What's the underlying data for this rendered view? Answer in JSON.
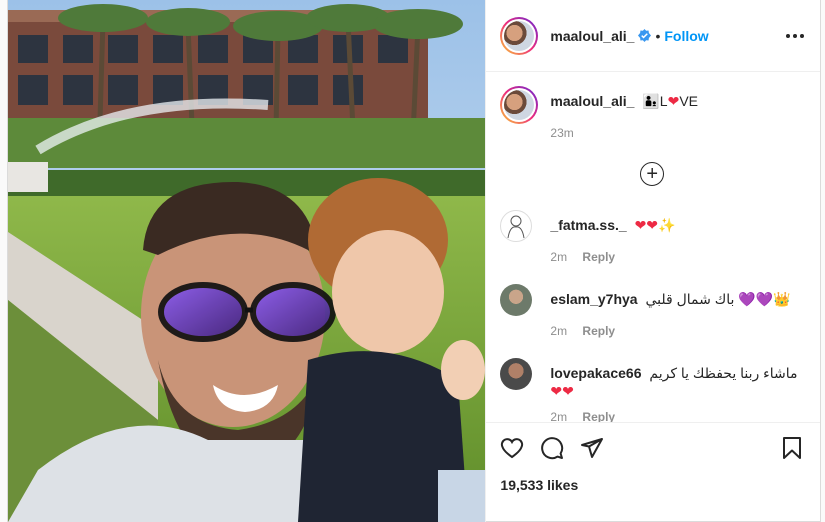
{
  "post": {
    "author": "maaloul_ali_",
    "follow_label": "Follow",
    "separator": "•",
    "caption_text": "L",
    "caption_tail": "VE",
    "caption_time": "23m",
    "likes": "19,533 likes"
  },
  "comments": [
    {
      "user": "_fatma.ss._",
      "text": "",
      "time": "2m",
      "reply": "Reply"
    },
    {
      "user": "eslam_y7hya",
      "text": "باك شمال قلبي",
      "time": "2m",
      "reply": "Reply"
    },
    {
      "user": "lovepakace66",
      "text": "ماشاء ربنا يحفظك يا كريم",
      "time": "2m",
      "reply": "Reply"
    }
  ],
  "icons": {
    "verified": "verified-badge-icon",
    "more": "more-options-icon",
    "load_more": "plus-circle-icon",
    "like": "heart-icon",
    "comment": "comment-icon",
    "share": "share-icon",
    "save": "bookmark-icon"
  },
  "colors": {
    "accent": "#0095f6",
    "heart": "#ed2a44",
    "purple_heart": "#8a4ae0",
    "text": "#262626",
    "muted": "#8e8e8e"
  }
}
